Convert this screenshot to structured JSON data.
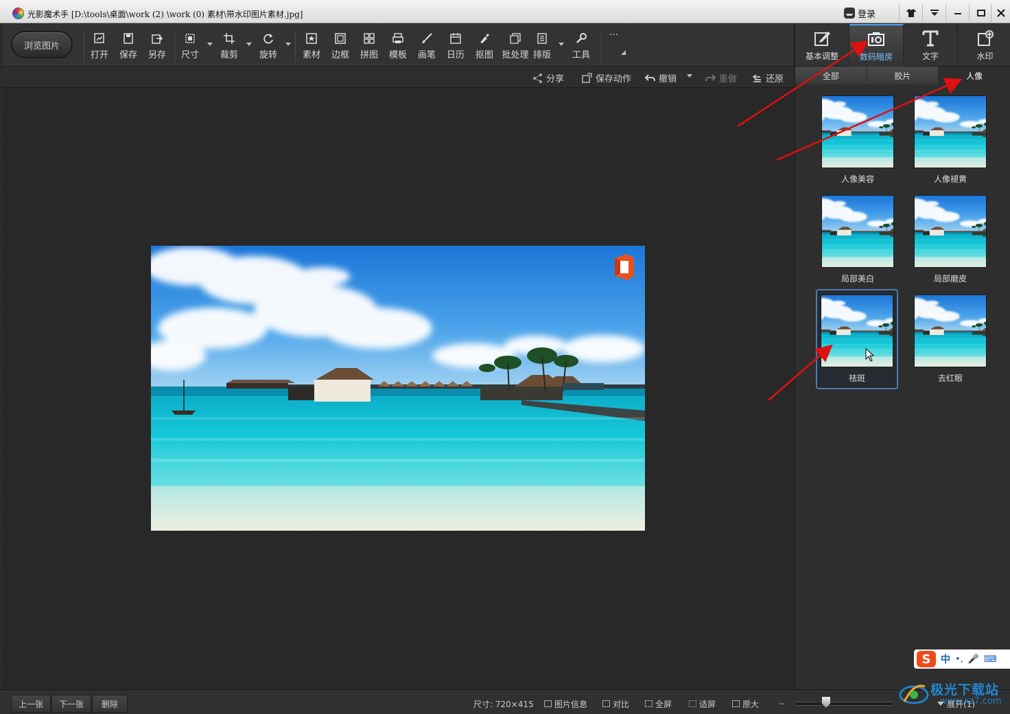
{
  "window": {
    "title": "光影魔术手 [D:\\tools\\桌面\\work (2) \\work (0) 素材\\带水印图片素材.jpg]",
    "login": "登录",
    "controls": [
      "👕",
      "⏷",
      "─",
      "▭",
      "✕"
    ]
  },
  "toolbar": {
    "browse": "浏览图片",
    "tools": [
      {
        "label": "打开",
        "icon": "open-icon"
      },
      {
        "label": "保存",
        "icon": "save-icon"
      },
      {
        "label": "另存",
        "icon": "save-as-icon"
      },
      {
        "label": "尺寸",
        "icon": "resize-icon"
      },
      {
        "label": "裁剪",
        "icon": "crop-icon"
      },
      {
        "label": "旋转",
        "icon": "rotate-icon"
      },
      {
        "label": "素材",
        "icon": "material-icon"
      },
      {
        "label": "边框",
        "icon": "border-icon"
      },
      {
        "label": "拼图",
        "icon": "collage-icon"
      },
      {
        "label": "模板",
        "icon": "template-icon"
      },
      {
        "label": "画笔",
        "icon": "brush-icon"
      },
      {
        "label": "日历",
        "icon": "calendar-icon"
      },
      {
        "label": "抠图",
        "icon": "cutout-icon"
      },
      {
        "label": "批处理",
        "icon": "batch-icon"
      },
      {
        "label": "排版",
        "icon": "layout-icon"
      },
      {
        "label": "工具",
        "icon": "wrench-icon"
      }
    ],
    "more": "···"
  },
  "actions": {
    "share": "分享",
    "save_action": "保存动作",
    "undo": "撤销",
    "redo": "重做",
    "restore": "还原"
  },
  "right_panel": {
    "tabs": [
      {
        "label": "基本调整",
        "icon": "edit-icon"
      },
      {
        "label": "数码暗房",
        "icon": "camera-icon",
        "active": true
      },
      {
        "label": "文字",
        "icon": "text-icon"
      },
      {
        "label": "水印",
        "icon": "watermark-icon"
      }
    ],
    "subtabs": [
      {
        "label": "全部"
      },
      {
        "label": "胶片"
      },
      {
        "label": "人像",
        "active": true
      }
    ],
    "effects": [
      {
        "label": "人像美容"
      },
      {
        "label": "人像褪黄"
      },
      {
        "label": "局部美白"
      },
      {
        "label": "局部磨皮"
      },
      {
        "label": "祛斑",
        "selected": true
      },
      {
        "label": "去红眼"
      }
    ]
  },
  "statusbar": {
    "prev": "上一张",
    "next": "下一张",
    "delete": "删除",
    "size": "尺寸: 720×415",
    "info": "图片信息",
    "compare": "对比",
    "fullscreen": "全屏",
    "fit": "适屏",
    "original": "原大",
    "minus": "−",
    "expand": "展开(1)"
  },
  "ime": {
    "logo": "S",
    "mode": "中",
    "punct": "•,",
    "mic": "🎤",
    "keyboard": "⌨"
  },
  "site_watermark": {
    "name": "极光下载站",
    "url": "www.xz7.com"
  },
  "colors": {
    "active_tab": "#4ea3ff",
    "arrow": "#e01010",
    "selected_border": "#4f7bb4"
  }
}
